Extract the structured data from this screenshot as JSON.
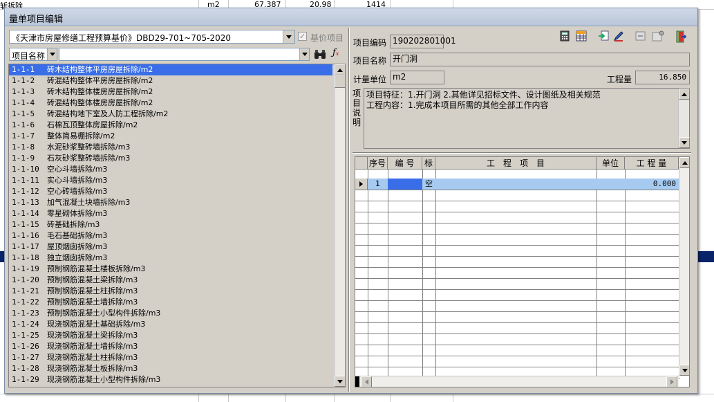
{
  "background": {
    "row_label": "斩拆除",
    "unit": "m2",
    "value1": "67.387",
    "value2": "20.98",
    "value3": "1414"
  },
  "window": {
    "title": "量单项目编辑"
  },
  "quota": {
    "selected": "《天津市房屋修缮工程预算基价》DBD29-701~705-2020",
    "base_price_label": "基价项目",
    "base_price_checked": "✓",
    "search_field": "项目名称",
    "search_value": ""
  },
  "list": [
    {
      "code": "1-1-1",
      "name": "砖木结构整体平房房屋拆除/m2"
    },
    {
      "code": "1-1-2",
      "name": "砖混结构整体平房房屋拆除/m2"
    },
    {
      "code": "1-1-3",
      "name": "砖木结构整体楼房房屋拆除/m2"
    },
    {
      "code": "1-1-4",
      "name": "砖混结构整体楼房房屋拆除/m2"
    },
    {
      "code": "1-1-5",
      "name": "砖混结构地下室及人防工程拆除/m2"
    },
    {
      "code": "1-1-6",
      "name": "石棉瓦顶整体房屋拆除/m2"
    },
    {
      "code": "1-1-7",
      "name": "整体简易棚拆除/m2"
    },
    {
      "code": "1-1-8",
      "name": "水泥砂浆整砖墙拆除/m3"
    },
    {
      "code": "1-1-9",
      "name": "石灰砂浆整砖墙拆除/m3"
    },
    {
      "code": "1-1-10",
      "name": "空心斗墙拆除/m3"
    },
    {
      "code": "1-1-11",
      "name": "实心斗墙拆除/m3"
    },
    {
      "code": "1-1-12",
      "name": "空心砖墙拆除/m3"
    },
    {
      "code": "1-1-13",
      "name": "加气混凝土块墙拆除/m3"
    },
    {
      "code": "1-1-14",
      "name": "零星砌体拆除/m3"
    },
    {
      "code": "1-1-15",
      "name": "砖基础拆除/m3"
    },
    {
      "code": "1-1-16",
      "name": "毛石基础拆除/m3"
    },
    {
      "code": "1-1-17",
      "name": "屋顶烟囱拆除/m3"
    },
    {
      "code": "1-1-18",
      "name": "独立烟囱拆除/m3"
    },
    {
      "code": "1-1-19",
      "name": "预制钢筋混凝土楼板拆除/m3"
    },
    {
      "code": "1-1-20",
      "name": "预制钢筋混凝土梁拆除/m3"
    },
    {
      "code": "1-1-21",
      "name": "预制钢筋混凝土柱拆除/m3"
    },
    {
      "code": "1-1-22",
      "name": "预制钢筋混凝土墙拆除/m3"
    },
    {
      "code": "1-1-23",
      "name": "预制钢筋混凝土小型构件拆除/m3"
    },
    {
      "code": "1-1-24",
      "name": "现浇钢筋混凝土基础拆除/m3"
    },
    {
      "code": "1-1-25",
      "name": "现浇钢筋混凝土梁拆除/m3"
    },
    {
      "code": "1-1-26",
      "name": "现浇钢筋混凝土墙拆除/m3"
    },
    {
      "code": "1-1-27",
      "name": "现浇钢筋混凝土柱拆除/m3"
    },
    {
      "code": "1-1-28",
      "name": "现浇钢筋混凝土板拆除/m3"
    },
    {
      "code": "1-1-29",
      "name": "现浇钢筋混凝土小型构件拆除/m3"
    }
  ],
  "detail": {
    "code_label": "项目编码",
    "code_value": "190202801001",
    "name_label": "项目名称",
    "name_value": "开门洞",
    "unit_label": "计量单位",
    "unit_value": "m2",
    "qty_label": "工程量",
    "qty_value": "16.850",
    "desc_label": "项目说明",
    "desc_line1": "项目特征：1.开门洞 2.其他详见招标文件、设计图纸及相关规范",
    "desc_line2": "工程内容：1.完成本项目所需的其他全部工作内容"
  },
  "toolbar": [
    "calculator-icon",
    "table-icon",
    "import-icon",
    "edit-icon",
    "export-icon",
    "settings-icon",
    "exit-icon"
  ],
  "grid": {
    "headers": [
      "序号",
      "编 号",
      "标",
      "工　程　项　目",
      "单位",
      "工 程 量"
    ],
    "row": {
      "seq": "1",
      "code": "",
      "flag": "空",
      "item": "",
      "unit": "",
      "qty": "0.000"
    }
  },
  "colors": {
    "selection": "#3a6ee8",
    "row_highlight": "#a6caf0",
    "title_bar": "#c5d0e0"
  }
}
